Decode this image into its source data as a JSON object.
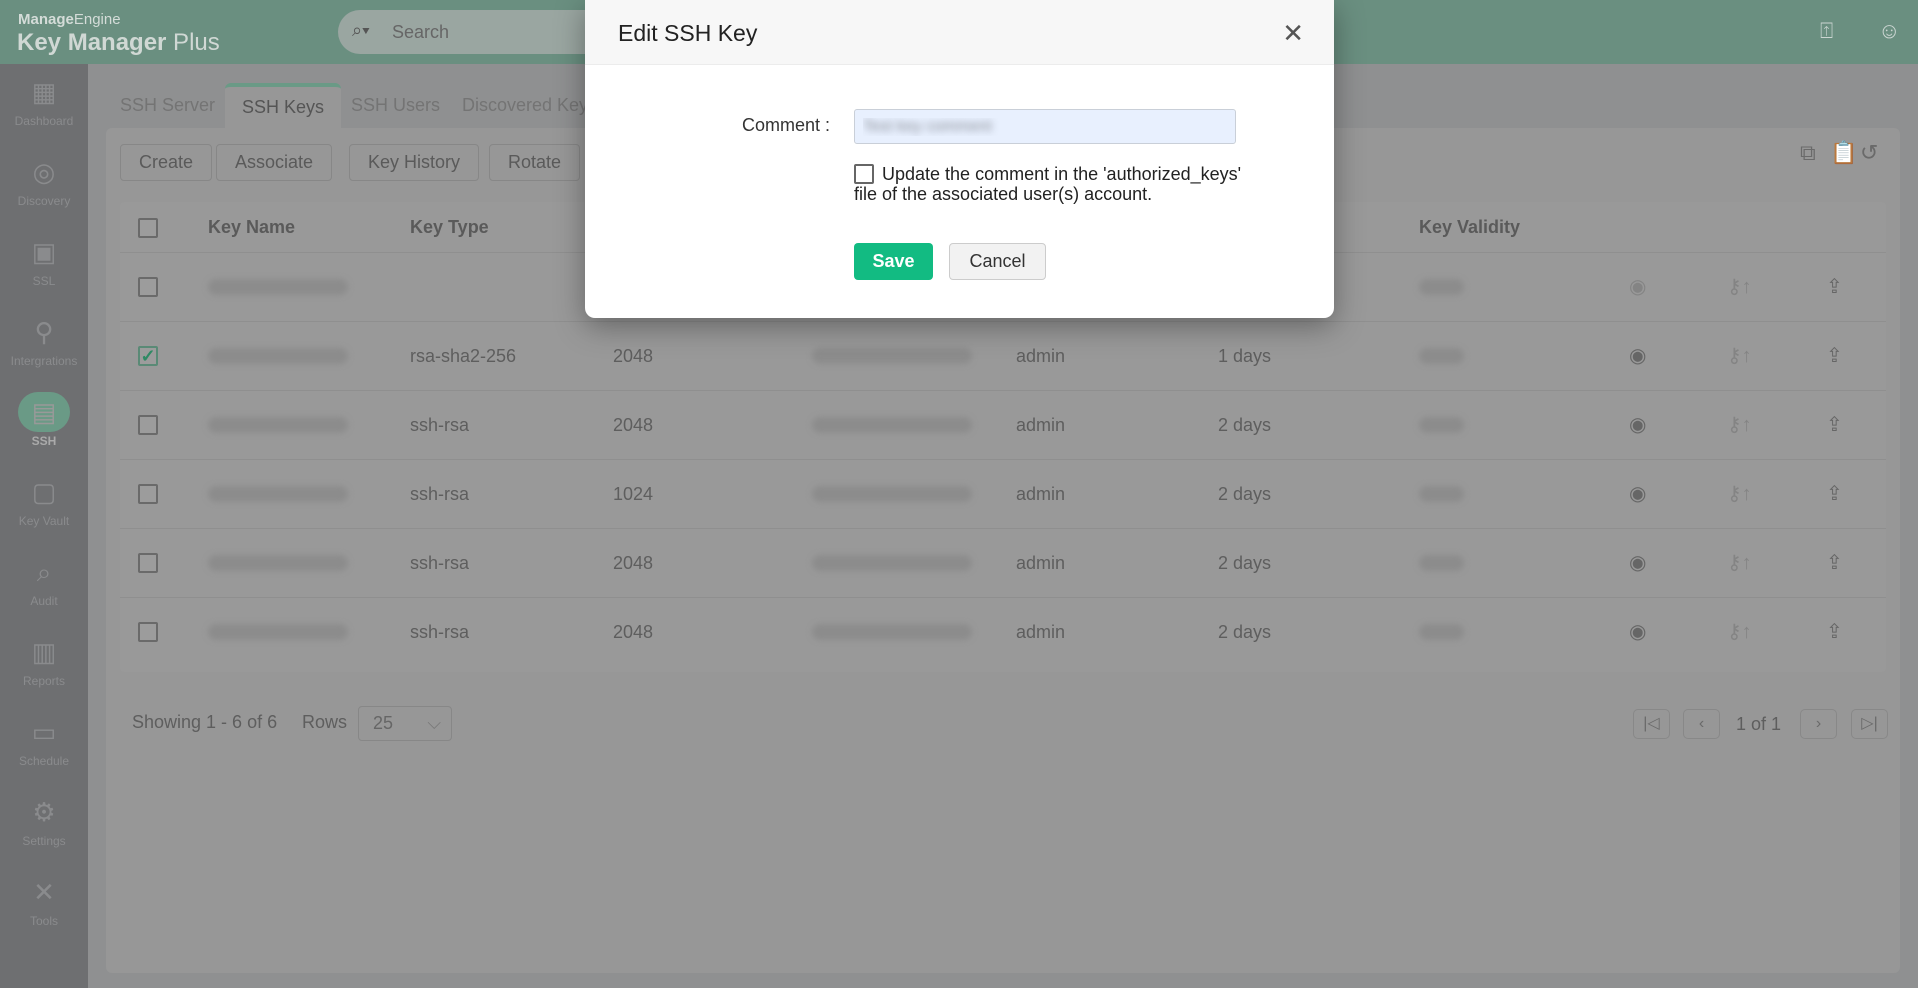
{
  "header": {
    "brand_top_bold": "Manage",
    "brand_top": "Engine",
    "brand_bold": "Key Manager",
    "brand": " Plus",
    "search_placeholder": "Search",
    "icons": [
      "search-icon",
      "notification-icon",
      "user-icon"
    ]
  },
  "sidebar": {
    "items": [
      {
        "label": "Dashboard",
        "icon": "▦"
      },
      {
        "label": "Discovery",
        "icon": "◎"
      },
      {
        "label": "SSL",
        "icon": "▣"
      },
      {
        "label": "Intergrations",
        "icon": "⚲"
      },
      {
        "label": "SSH",
        "icon": "▤",
        "active": true
      },
      {
        "label": "Key Vault",
        "icon": "▢"
      },
      {
        "label": "Audit",
        "icon": "⌕"
      },
      {
        "label": "Reports",
        "icon": "▥"
      },
      {
        "label": "Schedule",
        "icon": "▭"
      },
      {
        "label": "Settings",
        "icon": "⚙"
      },
      {
        "label": "Tools",
        "icon": "✕"
      }
    ]
  },
  "tabs": [
    "SSH Server",
    "SSH Keys",
    "SSH Users",
    "Discovered Key"
  ],
  "toolbar": {
    "buttons": [
      "Create",
      "Associate",
      "Key History",
      "Rotate"
    ]
  },
  "table": {
    "headers": {
      "key_name": "Key Name",
      "key_type": "Key Type",
      "key_validity": "Key Validity"
    },
    "rows": [
      {
        "checked": false,
        "key_type": "",
        "length": "",
        "created_by": "",
        "age": ""
      },
      {
        "checked": true,
        "key_type": "rsa-sha2-256",
        "length": "2048",
        "created_by": "admin",
        "age": "1 days"
      },
      {
        "checked": false,
        "key_type": "ssh-rsa",
        "length": "2048",
        "created_by": "admin",
        "age": "2 days"
      },
      {
        "checked": false,
        "key_type": "ssh-rsa",
        "length": "1024",
        "created_by": "admin",
        "age": "2 days"
      },
      {
        "checked": false,
        "key_type": "ssh-rsa",
        "length": "2048",
        "created_by": "admin",
        "age": "2 days"
      },
      {
        "checked": false,
        "key_type": "ssh-rsa",
        "length": "2048",
        "created_by": "admin",
        "age": "2 days"
      }
    ]
  },
  "footer": {
    "showing": "Showing 1 - 6 of 6",
    "rows_label": "Rows",
    "rows_value": "25",
    "page_info": "1 of 1"
  },
  "dialog": {
    "title": "Edit SSH Key",
    "comment_label": "Comment :",
    "comment_value": "Test key comment",
    "checkbox_label": "Update the comment in the 'authorized_keys' file of the associated user(s) account.",
    "save": "Save",
    "cancel": "Cancel"
  },
  "colors": {
    "accent": "#12bb82",
    "brand": "#6a9a86"
  }
}
